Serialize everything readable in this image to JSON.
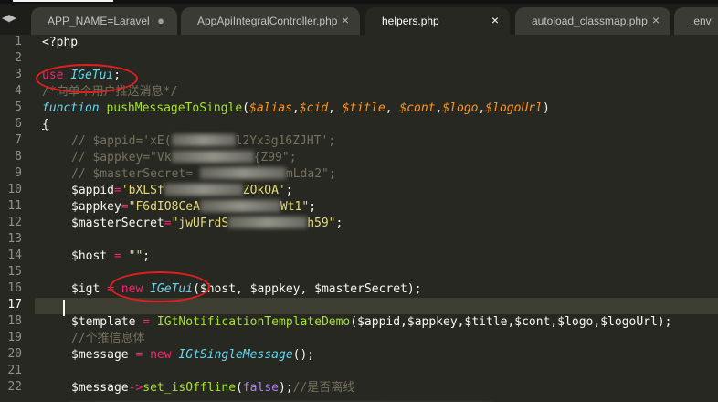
{
  "tabs": [
    {
      "label": "APP_NAME=Laravel",
      "marker": "●",
      "active": false
    },
    {
      "label": "AppApiIntegralController.php",
      "close": "×",
      "active": false
    },
    {
      "label": "helpers.php",
      "close": "×",
      "active": true
    },
    {
      "label": "autoload_classmap.php",
      "close": "×",
      "active": false
    },
    {
      "label": ".env",
      "active": false
    }
  ],
  "nav_arrows": "◀▶",
  "line_numbers": [
    "1",
    "2",
    "3",
    "4",
    "5",
    "6",
    "7",
    "8",
    "9",
    "10",
    "11",
    "12",
    "13",
    "14",
    "15",
    "16",
    "17",
    "18",
    "19",
    "20",
    "21",
    "22"
  ],
  "current_line": "17",
  "code": {
    "l1_php_open": "<?php",
    "l3_use": "use",
    "l3_class": "IGeTui",
    "l3_semi": ";",
    "l4_comment": "/*向单个用户推送消息*/",
    "l5_function": "function",
    "l5_name": "pushMessageToSingle",
    "l5_open": "(",
    "l5_p1": "$alias",
    "l5_p2": "$cid",
    "l5_p3": "$title",
    "l5_p4": "$cont",
    "l5_p5": "$logo",
    "l5_p6": "$logoUrl",
    "l5_close": ")",
    "l6_brace": "{",
    "l7_a": "// $appid='xE(",
    "l7_b": "l2Yx3g16ZJHT';",
    "l8_a": "// $appkey=\"Vk",
    "l8_b": "{Z99\";",
    "l9_a": "// $masterSecret= ",
    "l9_b": "mLda2\";",
    "l10_var": "$appid",
    "l10_eq": "=",
    "l10_s1": "'bXLSf",
    "l10_s2": "ZOkOA'",
    "l10_semi": ";",
    "l11_var": "$appkey",
    "l11_eq": "=",
    "l11_s1": "\"F6dIO8CeA",
    "l11_s2": "Wt1\"",
    "l11_semi": ";",
    "l12_var": "$masterSecret",
    "l12_eq": "=",
    "l12_s1": "\"jwUFrdS",
    "l12_s2": "h59\"",
    "l12_semi": ";",
    "l14_var": "$host ",
    "l14_eq": "=",
    "l14_str": " \"\"",
    "l14_semi": ";",
    "l16_var": "$igt ",
    "l16_eq": "=",
    "l16_new": " new",
    "l16_class": " IGeTui",
    "l16_args": "($host, $appkey, $masterSecret);",
    "l18_var": "$template ",
    "l18_eq": "=",
    "l18_class": " IGtNotificationTemplateDemo",
    "l18_args": "($appid,$appkey,$title,$cont,$logo,$logoUrl);",
    "l19_comment": "//个推信息体",
    "l20_var": "$message ",
    "l20_eq": "=",
    "l20_new": " new",
    "l20_class": " IGtSingleMessage",
    "l20_args": "();",
    "l22_var": "$message",
    "l22_arrow": "->",
    "l22_fn": "set_isOffline",
    "l22_open": "(",
    "l22_bool": "false",
    "l22_close": ");",
    "l22_comment": "//是否离线"
  }
}
